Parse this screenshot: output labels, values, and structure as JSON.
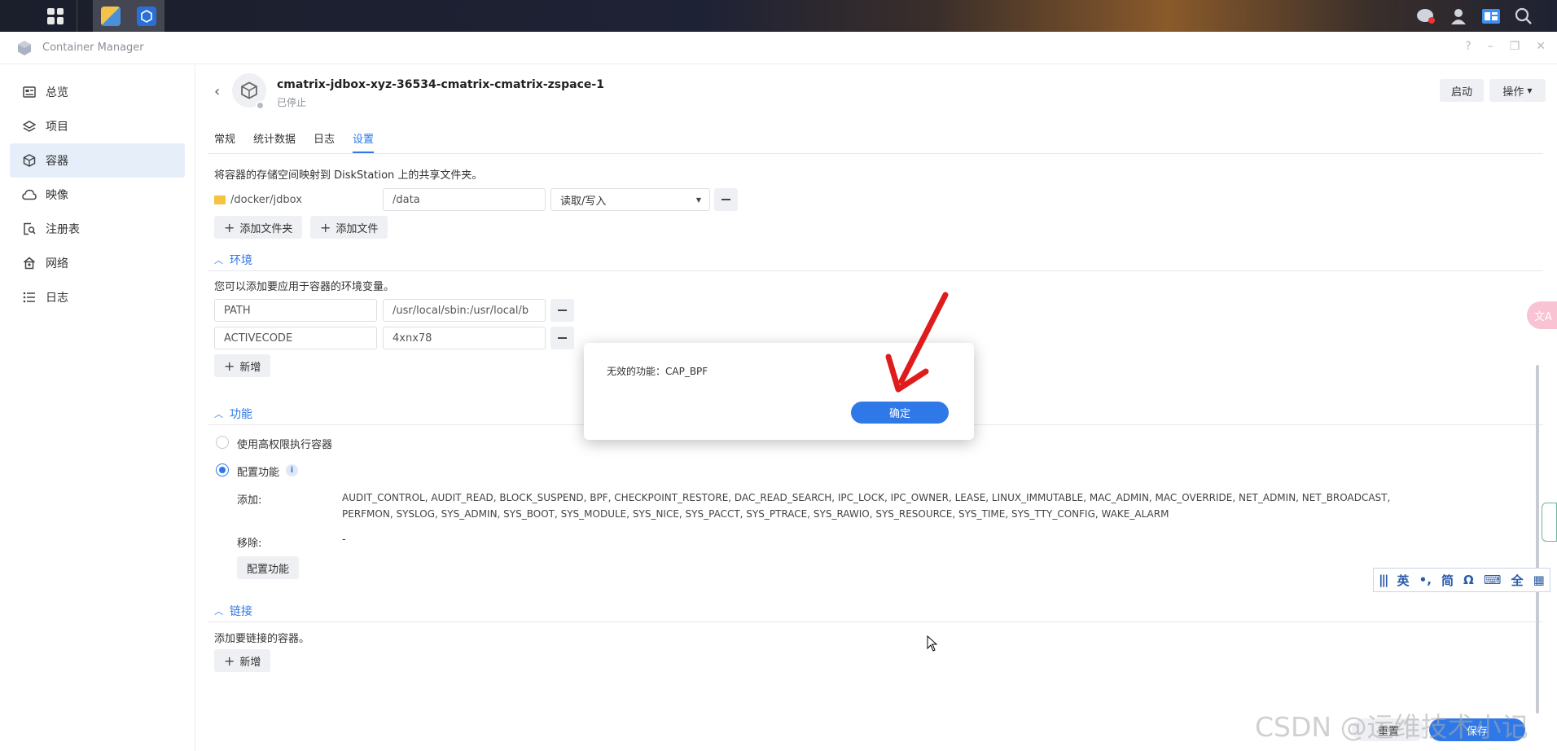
{
  "taskbar": {
    "icons": [
      "apps-grid-icon",
      "notes-app-icon",
      "container-manager-app-icon"
    ],
    "right_icons": [
      "chat-icon",
      "user-icon",
      "widgets-icon",
      "search-icon"
    ]
  },
  "window": {
    "title": "Container Manager",
    "controls": [
      "?",
      "–",
      "❐",
      "✕"
    ]
  },
  "sidebar": {
    "items": [
      {
        "label": "总览",
        "icon": "overview-icon"
      },
      {
        "label": "项目",
        "icon": "layers-icon"
      },
      {
        "label": "容器",
        "icon": "cube-icon"
      },
      {
        "label": "映像",
        "icon": "cloud-icon"
      },
      {
        "label": "注册表",
        "icon": "registry-icon"
      },
      {
        "label": "网络",
        "icon": "network-icon"
      },
      {
        "label": "日志",
        "icon": "list-icon"
      }
    ],
    "active_index": 2
  },
  "container": {
    "name": "cmatrix-jdbox-xyz-36534-cmatrix-cmatrix-zspace-1",
    "status": "已停止",
    "start_label": "启动",
    "actions_label": "操作"
  },
  "tabs": {
    "items": [
      "常规",
      "统计数据",
      "日志",
      "设置"
    ],
    "active_index": 3
  },
  "volume": {
    "description": "将容器的存储空间映射到 DiskStation 上的共享文件夹。",
    "folder_path": "/docker/jdbox",
    "mount_path": "/data",
    "mode": "读取/写入",
    "add_folder_label": "添加文件夹",
    "add_file_label": "添加文件"
  },
  "environment": {
    "title": "环境",
    "description": "您可以添加要应用于容器的环境变量。",
    "vars": [
      {
        "key": "PATH",
        "value": "/usr/local/sbin:/usr/local/b"
      },
      {
        "key": "ACTIVECODE",
        "value": "4xnx78"
      }
    ],
    "add_label": "新增"
  },
  "capabilities": {
    "title": "功能",
    "privileged_label": "使用高权限执行容器",
    "configure_label": "配置功能",
    "add_label": "添加:",
    "add_values_line1": "AUDIT_CONTROL, AUDIT_READ, BLOCK_SUSPEND, BPF, CHECKPOINT_RESTORE, DAC_READ_SEARCH, IPC_LOCK, IPC_OWNER, LEASE, LINUX_IMMUTABLE, MAC_ADMIN, MAC_OVERRIDE, NET_ADMIN, NET_BROADCAST,",
    "add_values_line2": "PERFMON, SYSLOG, SYS_ADMIN, SYS_BOOT, SYS_MODULE, SYS_NICE, SYS_PACCT, SYS_PTRACE, SYS_RAWIO, SYS_RESOURCE, SYS_TIME, SYS_TTY_CONFIG, WAKE_ALARM",
    "remove_label": "移除:",
    "remove_value": "-",
    "configure_button_label": "配置功能"
  },
  "links": {
    "title": "链接",
    "description": "添加要链接的容器。",
    "add_label": "新增"
  },
  "dialog": {
    "message": "无效的功能：CAP_BPF",
    "ok_label": "确定"
  },
  "ime": {
    "items": [
      "英",
      "简",
      "Ω",
      "全"
    ]
  },
  "footer": {
    "reset_label": "重置",
    "save_label": "保存"
  },
  "watermark": "CSDN @运维技术小记",
  "colors": {
    "accent": "#2f78e7",
    "arrow": "#e01b1b",
    "sidebar_active": "#e6eef9"
  }
}
